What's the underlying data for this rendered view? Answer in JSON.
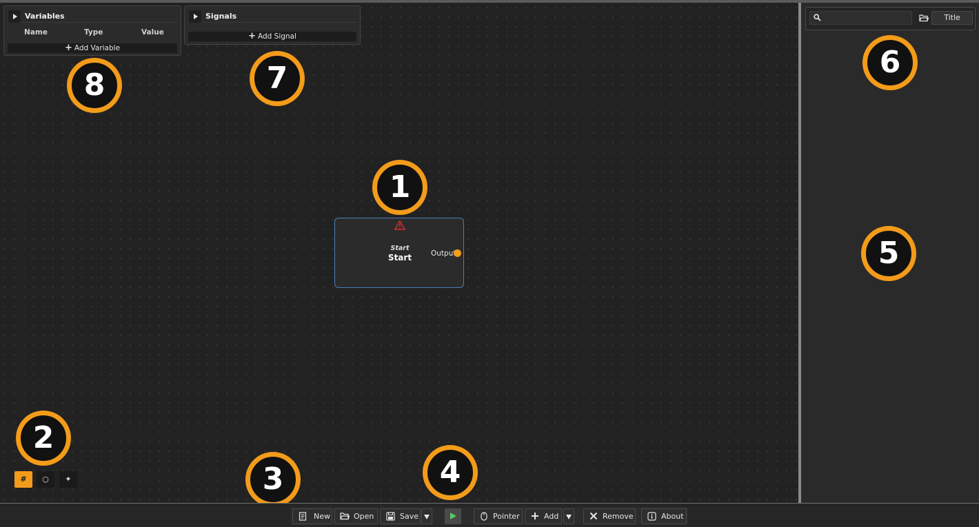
{
  "colors": {
    "accent": "#f39b1a",
    "node_border": "#4d7fb8",
    "warning": "#e03030",
    "run_green": "#5cc85c"
  },
  "variables_panel": {
    "title": "Variables",
    "columns": [
      "Name",
      "Type",
      "Value"
    ],
    "add_label": "Add Variable"
  },
  "signals_panel": {
    "title": "Signals",
    "add_label": "Add Signal"
  },
  "node": {
    "warning_icon": "warning-triangle-icon",
    "subtitle": "Start",
    "title": "Start",
    "output_label": "Output"
  },
  "sidebar": {
    "search_value": "",
    "title_button": "Title"
  },
  "badges": [
    "1",
    "2",
    "3",
    "4",
    "5",
    "6",
    "7",
    "8"
  ],
  "modes": [
    "#",
    "○",
    "✦"
  ],
  "toolbar": {
    "new": "New",
    "open": "Open",
    "save": "Save",
    "pointer": "Pointer",
    "add": "Add",
    "remove": "Remove",
    "about": "About"
  }
}
